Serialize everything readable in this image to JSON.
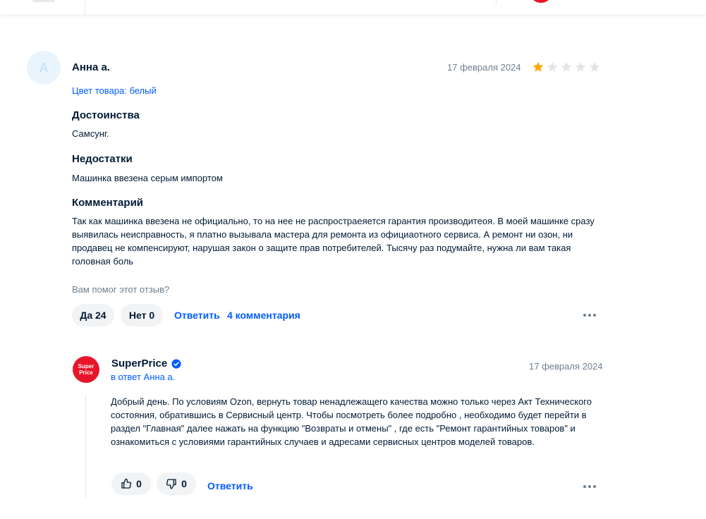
{
  "review": {
    "avatar_letter": "A",
    "author": "Анна а.",
    "date": "17 февраля 2024",
    "rating": 1,
    "rating_max": 5,
    "color_label": "Цвет товара: белый",
    "pros_title": "Достоинства",
    "pros_text": "Самсунг.",
    "cons_title": "Недостатки",
    "cons_text": "Машинка ввезена серым импортом",
    "comment_title": "Комментарий",
    "comment_text": "Так как машинка ввезена не официально, то на нее не распростраеяется гарантия производитеоя. В моей машинке сразу выявилась неисправность, я платно вызывала мастера для ремонта из официаотного сервиса. А ремонт ни озон, ни продавец не компенсируют, нарушая закон о защите прав потребителей. Тысячу раз подумайте, нужна ли вам такая головная боль",
    "helpful_question": "Вам помог этот отзыв?",
    "yes_label": "Да 24",
    "no_label": "Нет 0",
    "reply_label": "Ответить",
    "comments_label": "4 комментария"
  },
  "answer": {
    "logo_text_1": "Super",
    "logo_text_2": "Price",
    "shop_name": "SuperPrice",
    "reply_to": "в ответ Анна а.",
    "date": "17 февраля 2024",
    "text": "Добрый день. По условиям Ozon, вернуть товар ненадлежащего качества можно только через Акт Технического состояния, обратившись в Сервисный центр. Чтобы посмотреть более подробно , необходимо будет перейти в раздел \"Главная\" далее нажать на функцию \"Возвраты и отмены\" , где есть \"Ремонт гарантийных товаров\" и ознакомиться с условиями гарантийных случаев и адресами сервисных центров моделей товаров.",
    "likes": "0",
    "dislikes": "0",
    "reply_label": "Ответить"
  },
  "colors": {
    "accent": "#005bff",
    "star_filled": "#ffa800",
    "star_empty": "#e2e5e8",
    "brand_red": "#e8152a"
  }
}
